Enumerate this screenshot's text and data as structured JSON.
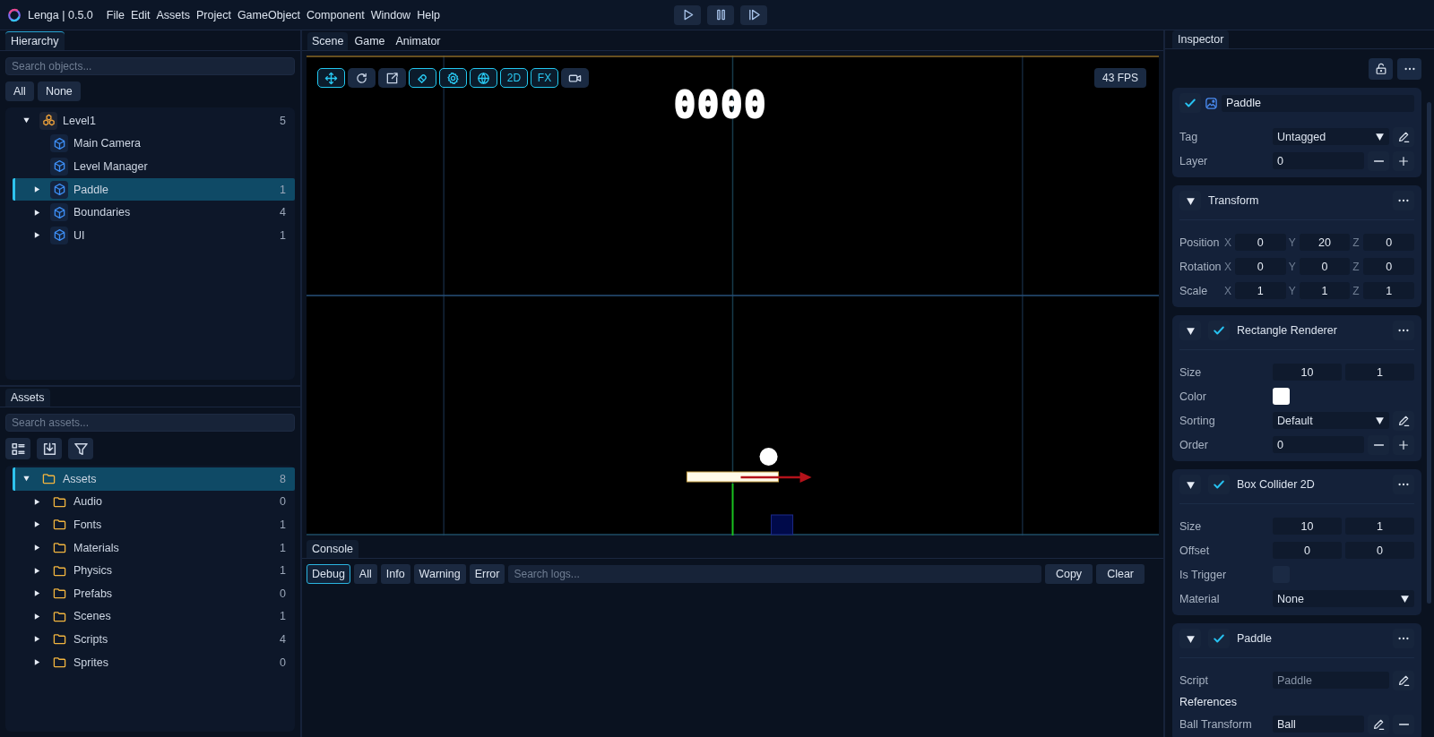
{
  "app": {
    "title": "Lenga | 0.5.0",
    "menu": [
      "File",
      "Edit",
      "Assets",
      "Project",
      "GameObject",
      "Component",
      "Window",
      "Help"
    ]
  },
  "hierarchy": {
    "tab": "Hierarchy",
    "search_placeholder": "Search objects...",
    "filters": [
      "All",
      "None"
    ],
    "tree": [
      {
        "name": "Level1",
        "kind": "scene",
        "count": "5",
        "expanded": true,
        "selected": false,
        "children": [
          {
            "name": "Main Camera",
            "kind": "object",
            "selected": false
          },
          {
            "name": "Level Manager",
            "kind": "object",
            "selected": false
          },
          {
            "name": "Paddle",
            "kind": "object",
            "count": "1",
            "expanded": false,
            "selected": true
          },
          {
            "name": "Boundaries",
            "kind": "object",
            "count": "4",
            "expanded": false,
            "selected": false
          },
          {
            "name": "UI",
            "kind": "object",
            "count": "1",
            "expanded": false,
            "selected": false
          }
        ]
      }
    ]
  },
  "assets": {
    "tab": "Assets",
    "search_placeholder": "Search assets...",
    "tree": [
      {
        "name": "Assets",
        "kind": "folder",
        "count": "8",
        "expanded": true,
        "selected": true,
        "children": [
          {
            "name": "Audio",
            "kind": "folder",
            "count": "0",
            "expanded": false,
            "selected": false
          },
          {
            "name": "Fonts",
            "kind": "folder",
            "count": "1",
            "expanded": false,
            "selected": false
          },
          {
            "name": "Materials",
            "kind": "folder",
            "count": "1",
            "expanded": false,
            "selected": false
          },
          {
            "name": "Physics",
            "kind": "folder",
            "count": "1",
            "expanded": false,
            "selected": false
          },
          {
            "name": "Prefabs",
            "kind": "folder",
            "count": "0",
            "expanded": false,
            "selected": false
          },
          {
            "name": "Scenes",
            "kind": "folder",
            "count": "1",
            "expanded": false,
            "selected": false
          },
          {
            "name": "Scripts",
            "kind": "folder",
            "count": "4",
            "expanded": false,
            "selected": false
          },
          {
            "name": "Sprites",
            "kind": "folder",
            "count": "0",
            "expanded": false,
            "selected": false
          }
        ]
      }
    ]
  },
  "view_tabs": [
    {
      "label": "Scene",
      "selected": true
    },
    {
      "label": "Game",
      "selected": false
    },
    {
      "label": "Animator",
      "selected": false
    }
  ],
  "scene": {
    "tools": [
      {
        "selected": true
      },
      {
        "selected": false
      },
      {
        "selected": false
      },
      {
        "selected": true
      },
      {
        "selected": true
      },
      {
        "selected": true
      },
      {
        "label": "2D",
        "selected": true
      },
      {
        "label": "FX",
        "selected": true
      },
      {
        "selected": false
      }
    ],
    "fps": "43 FPS",
    "score": "0000"
  },
  "console": {
    "tab": "Console",
    "filters": [
      {
        "label": "Debug",
        "selected": true
      },
      {
        "label": "All",
        "selected": false
      },
      {
        "label": "Info",
        "selected": false
      },
      {
        "label": "Warning",
        "selected": false
      },
      {
        "label": "Error",
        "selected": false
      }
    ],
    "search_placeholder": "Search logs...",
    "actions": [
      "Copy",
      "Clear"
    ]
  },
  "inspector": {
    "tab": "Inspector",
    "object": {
      "active": true,
      "name": "Paddle",
      "rows": [
        {
          "kind": "dropdown",
          "label": "Tag",
          "value": "Untagged",
          "edit": true
        },
        {
          "kind": "stepper",
          "label": "Layer",
          "value": "0"
        }
      ]
    },
    "components": [
      {
        "title": "Transform",
        "expanded": true,
        "rows": [
          {
            "kind": "xyz",
            "label": "Position",
            "axes": [
              {
                "axis": "X",
                "value": "0"
              },
              {
                "axis": "Y",
                "value": "20"
              },
              {
                "axis": "Z",
                "value": "0"
              }
            ]
          },
          {
            "kind": "xyz",
            "label": "Rotation",
            "axes": [
              {
                "axis": "X",
                "value": "0"
              },
              {
                "axis": "Y",
                "value": "0"
              },
              {
                "axis": "Z",
                "value": "0"
              }
            ]
          },
          {
            "kind": "xyz",
            "label": "Scale",
            "axes": [
              {
                "axis": "X",
                "value": "1"
              },
              {
                "axis": "Y",
                "value": "1"
              },
              {
                "axis": "Z",
                "value": "1"
              }
            ]
          }
        ]
      },
      {
        "title": "Rectangle Renderer",
        "enabled": true,
        "expanded": true,
        "rows": [
          {
            "kind": "pair",
            "label": "Size",
            "values": [
              "10",
              "1"
            ]
          },
          {
            "kind": "color",
            "label": "Color",
            "color": "#ffffff"
          },
          {
            "kind": "dropdown",
            "label": "Sorting",
            "value": "Default",
            "edit": true
          },
          {
            "kind": "stepper",
            "label": "Order",
            "value": "0"
          }
        ]
      },
      {
        "title": "Box Collider 2D",
        "enabled": true,
        "expanded": true,
        "rows": [
          {
            "kind": "pair",
            "label": "Size",
            "values": [
              "10",
              "1"
            ]
          },
          {
            "kind": "pair",
            "label": "Offset",
            "values": [
              "0",
              "0"
            ]
          },
          {
            "kind": "checkbox",
            "label": "Is Trigger",
            "checked": false
          },
          {
            "kind": "dropdown",
            "label": "Material",
            "value": "None",
            "edit": false
          }
        ]
      },
      {
        "title": "Paddle",
        "enabled": true,
        "expanded": true,
        "rows": [
          {
            "kind": "script",
            "label": "Script",
            "value": "Paddle"
          },
          {
            "kind": "heading",
            "label": "References"
          },
          {
            "kind": "reference",
            "label": "Ball Transform",
            "value": "Ball"
          }
        ]
      }
    ]
  }
}
